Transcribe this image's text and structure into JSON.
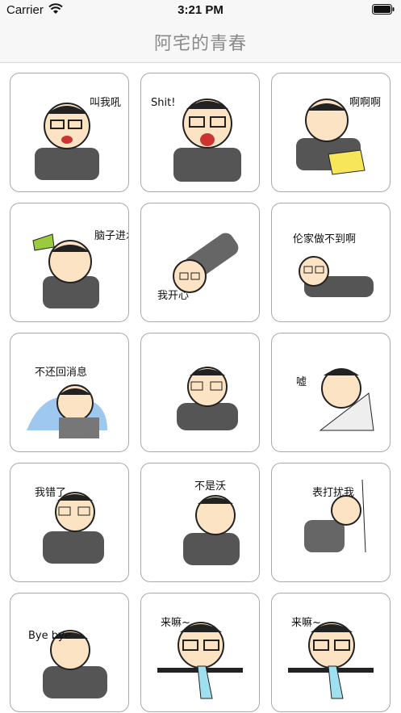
{
  "status": {
    "carrier": "Carrier",
    "time": "3:21 PM"
  },
  "nav": {
    "title": "阿宅的青春"
  },
  "stickers": [
    {
      "caption": "叫我吼",
      "icon": "sticker-icon"
    },
    {
      "caption": "Shit!",
      "icon": "sticker-icon"
    },
    {
      "caption": "啊啊啊",
      "icon": "sticker-icon"
    },
    {
      "caption": "脑子进水啦",
      "icon": "sticker-icon"
    },
    {
      "caption": "我开心",
      "icon": "sticker-icon"
    },
    {
      "caption": "伦家做不到啊",
      "icon": "sticker-icon"
    },
    {
      "caption": "不还回消息",
      "icon": "sticker-icon"
    },
    {
      "caption": "",
      "icon": "sticker-icon"
    },
    {
      "caption": "嘘",
      "icon": "sticker-icon"
    },
    {
      "caption": "我错了",
      "icon": "sticker-icon"
    },
    {
      "caption": "不是沃",
      "icon": "sticker-icon"
    },
    {
      "caption": "表打扰我",
      "icon": "sticker-icon"
    },
    {
      "caption": "Bye bye",
      "icon": "sticker-icon"
    },
    {
      "caption": "来嘛~",
      "icon": "sticker-icon"
    },
    {
      "caption": "来嘛~",
      "icon": "sticker-icon"
    }
  ]
}
